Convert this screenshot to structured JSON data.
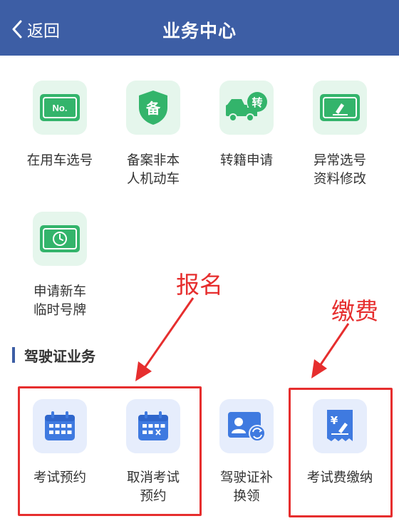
{
  "header": {
    "back_label": "返回",
    "title": "业务中心"
  },
  "vehicle_items": [
    {
      "label": "在用车选号",
      "icon": "license-plate-no-icon",
      "plate_text": "No."
    },
    {
      "label": "备案非本\n人机动车",
      "icon": "shield-bei-icon",
      "badge_text": "备"
    },
    {
      "label": "转籍申请",
      "icon": "truck-transfer-icon",
      "badge_text": "转"
    },
    {
      "label": "异常选号\n资料修改",
      "icon": "plate-edit-icon"
    },
    {
      "label": "申请新车\n临时号牌",
      "icon": "plate-clock-icon"
    }
  ],
  "section": {
    "title": "驾驶证业务"
  },
  "license_items": [
    {
      "label": "考试预约",
      "icon": "calendar-icon"
    },
    {
      "label": "取消考试\n预约",
      "icon": "calendar-cancel-icon"
    },
    {
      "label": "驾驶证补\n换领",
      "icon": "license-renew-icon"
    },
    {
      "label": "考试费缴纳",
      "icon": "fee-receipt-icon",
      "currency": "¥"
    }
  ],
  "annotations": {
    "signup": "报名",
    "payment": "缴费"
  },
  "colors": {
    "header": "#3d5ea5",
    "green_tile": "#e5f6ec",
    "green_icon": "#33b46b",
    "blue_tile": "#e6edfc",
    "blue_icon": "#3f7ae0",
    "annotation": "#e62e2e"
  }
}
